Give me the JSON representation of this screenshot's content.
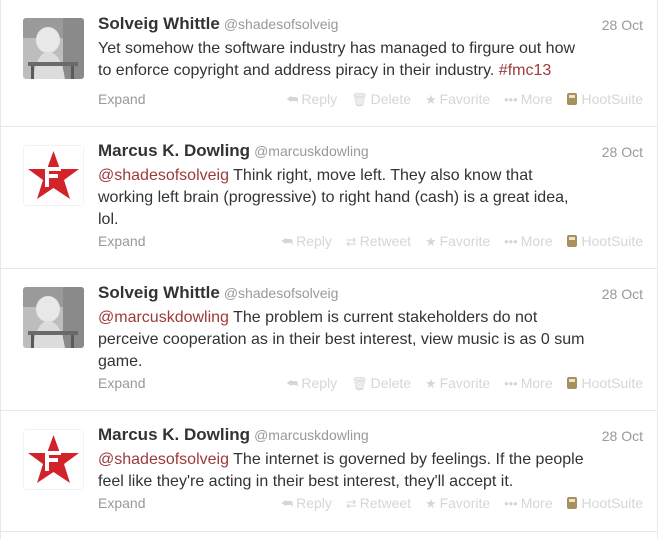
{
  "tweets": [
    {
      "fullname": "Solveig Whittle",
      "username": "@shadesofsolveig",
      "time": "28 Oct",
      "avatar": "photo",
      "line1": "Yet somehow the software industry has managed to firgure out how",
      "line2_prefix": "to enforce copyright and address piracy in their industry. ",
      "hashtag": "#fmc13",
      "own": true
    },
    {
      "fullname": "Marcus K. Dowling",
      "username": "@marcuskdowling",
      "time": "28 Oct",
      "avatar": "star",
      "mention": "@shadesofsolveig",
      "line1_rest": " Think right, move left. They also know that",
      "line2": "working left brain (progressive) to right hand (cash) is a great idea,",
      "line3": "lol.",
      "own": false
    },
    {
      "fullname": "Solveig Whittle",
      "username": "@shadesofsolveig",
      "time": "28 Oct",
      "avatar": "photo",
      "mention": "@marcuskdowling",
      "line1_rest": " The problem is current stakeholders do not",
      "line2": "perceive cooperation as in their best interest, view music is as 0 sum",
      "line3": "game.",
      "own": true
    },
    {
      "fullname": "Marcus K. Dowling",
      "username": "@marcuskdowling",
      "time": "28 Oct",
      "avatar": "star",
      "mention": "@shadesofsolveig",
      "line1_rest": " The internet is governed by feelings. If the people",
      "line2": "feel like they're acting in their best interest, they'll accept it.",
      "own": false
    }
  ],
  "actions": {
    "expand": "Expand",
    "reply": "Reply",
    "retweet": "Retweet",
    "delete": "Delete",
    "favorite": "Favorite",
    "more": "More",
    "hootsuite": "HootSuite"
  },
  "icons": {
    "reply": "reply-arrow-icon",
    "retweet": "retweet-icon",
    "delete": "trash-icon",
    "favorite": "star-icon",
    "more": "ellipsis-icon",
    "hootsuite": "hootsuite-owl-icon"
  },
  "colors": {
    "link": "#9c3a3a",
    "avatar_red": "#d2232a"
  }
}
